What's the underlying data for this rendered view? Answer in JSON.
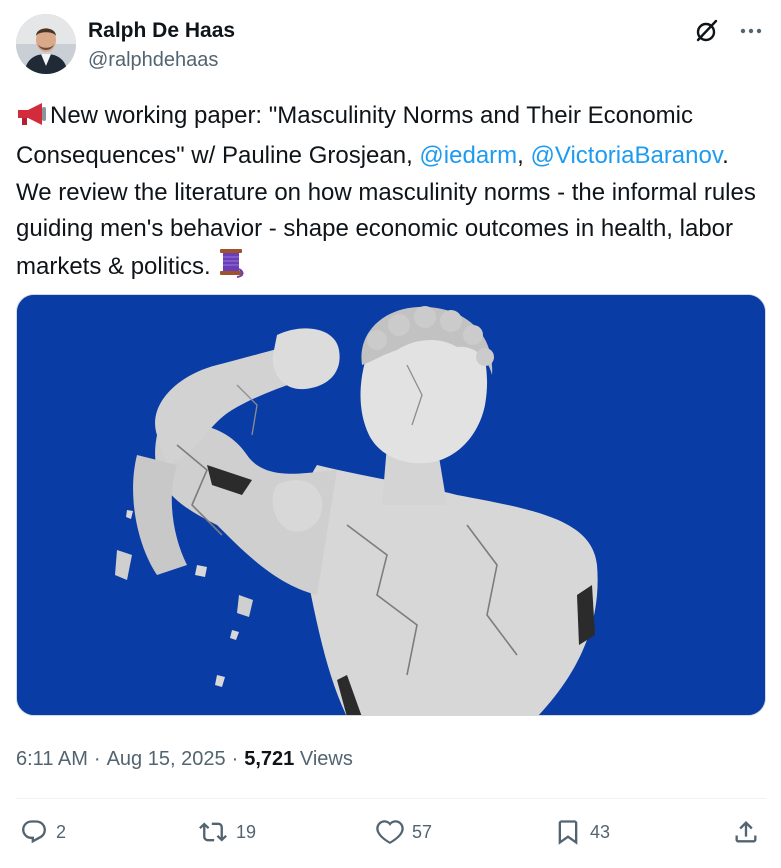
{
  "author": {
    "display_name": "Ralph De Haas",
    "handle": "@ralphdehaas"
  },
  "tweet": {
    "text_1": "New working paper: \"Masculinity Norms and Their Economic Consequences\" w/ Pauline Grosjean, ",
    "mention_1": "@iedarm",
    "text_2": ", ",
    "mention_2": "@VictoriaBaranov",
    "text_3": ". We review the literature on how masculinity norms - the informal rules guiding men's behavior - shape economic outcomes in health, labor markets & politics. ",
    "leading_emoji": "megaphone-emoji",
    "trailing_emoji": "thread-spool-emoji"
  },
  "media": {
    "icon": "marble-statue-flexing-illustration",
    "background_color": "#0a3ca6"
  },
  "meta": {
    "time": "6:11 AM",
    "separator": "·",
    "date": "Aug 15, 2025",
    "separator_2": "·",
    "views_count": "5,721",
    "views_label": "Views"
  },
  "actions": {
    "replies": "2",
    "reposts": "19",
    "likes": "57",
    "bookmarks": "43"
  },
  "colors": {
    "text": "#0f1419",
    "secondary": "#536471",
    "link": "#1d9bf0"
  }
}
